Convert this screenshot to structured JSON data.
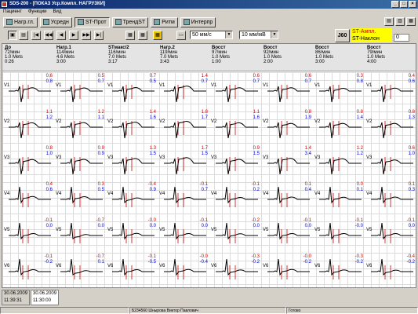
{
  "window": {
    "title": "SDS-200 - [ПОКАЗ Уср.Компл. НАГРУЗКИ]"
  },
  "menu": [
    "Пациент",
    "Функции",
    "Вид"
  ],
  "toolbar": [
    "Нагр.гл.",
    "Усредн",
    "ST-Прот",
    "ТрендST",
    "Ритм",
    "Интерпр"
  ],
  "speed": "50 мм/с",
  "gain": "10 мм/мВ",
  "j_label": "J60",
  "st_legend": {
    "line1": "ST-Ампл.",
    "line2": "ST-Наклон"
  },
  "zero_value": "0",
  "stages": [
    {
      "name": "До",
      "hr": "72/мин",
      "mets": "1.0 Mets",
      "time": "0:26"
    },
    {
      "name": "Нагр.1",
      "hr": "114/мин",
      "mets": "4.6 Mets",
      "time": "3:00"
    },
    {
      "name": "STмакс/2",
      "hr": "116/мин",
      "mets": "7.0 Mets",
      "time": "3:17"
    },
    {
      "name": "Нагр.2",
      "hr": "119/мин",
      "mets": "7.0 Mets",
      "time": "3:43"
    },
    {
      "name": "Восст",
      "hr": "97/мин",
      "mets": "1.0 Mets",
      "time": "1:00"
    },
    {
      "name": "Восст",
      "hr": "92/мин",
      "mets": "1.0 Mets",
      "time": "2:00"
    },
    {
      "name": "Восст",
      "hr": "86/мин",
      "mets": "1.0 Mets",
      "time": "3:00"
    },
    {
      "name": "Восст",
      "hr": "79/мин",
      "mets": "1.0 Mets",
      "time": "4:00"
    }
  ],
  "leads": [
    {
      "lead": "V1",
      "amp": [
        "0.6",
        "0.5",
        "0.7",
        "1.4",
        "0.6",
        "0.6",
        "0.3",
        "0.4"
      ],
      "slope": [
        "0.8",
        "0.7",
        "0.5",
        "0.7",
        "0.7",
        "0.7",
        "0.8",
        "0.6"
      ]
    },
    {
      "lead": "V2",
      "amp": [
        "1.1",
        "1.2",
        "1.4",
        "1.8",
        "1.1",
        "0.8",
        "0.8",
        "0.8"
      ],
      "slope": [
        "1.2",
        "1.1",
        "1.6",
        "1.7",
        "1.6",
        "1.9",
        "1.4",
        "1.3"
      ]
    },
    {
      "lead": "V3",
      "amp": [
        "0.8",
        "0.9",
        "1.3",
        "1.7",
        "0.9",
        "1.4",
        "1.2",
        "0.6"
      ],
      "slope": [
        "1.0",
        "0.9",
        "1.5",
        "1.5",
        "1.5",
        "3.4",
        "1.2",
        "1.0"
      ]
    },
    {
      "lead": "V4",
      "amp": [
        "0.4",
        "0.3",
        "-0.4",
        "-0.1",
        "-0.1",
        "0.1",
        "0.0",
        "0.1"
      ],
      "slope": [
        "0.6",
        "0.5",
        "0.9",
        "0.7",
        "0.2",
        "0.4",
        "0.1",
        "0.3"
      ]
    },
    {
      "lead": "V5",
      "amp": [
        "-0.1",
        "-0.7",
        "-0.0",
        "-0.1",
        "-0.2",
        "-0.1",
        "-0.1",
        "-0.1"
      ],
      "slope": [
        "0.0",
        "0.0",
        "0.0",
        "0.0",
        "0.0",
        "0.0",
        "-0.0",
        "0.0"
      ]
    },
    {
      "lead": "V6",
      "amp": [
        "-0.1",
        "-0.7",
        "-0.1",
        "-0.0",
        "-0.3",
        "-0.0",
        "-0.3",
        "-0.4"
      ],
      "slope": [
        "-0.2",
        "0.1",
        "-0.5",
        "-0.4",
        "-0.2",
        "-0.2",
        "-0.2",
        "-0.2"
      ]
    }
  ],
  "tabs": [
    {
      "date": "30.06.2009",
      "time": "11:39:31"
    },
    {
      "date": "30.06.2009",
      "time": "11:30:00"
    }
  ],
  "status": {
    "patient": "Б234560   Шнырова Виктор Павлович",
    "state": "Готово"
  }
}
